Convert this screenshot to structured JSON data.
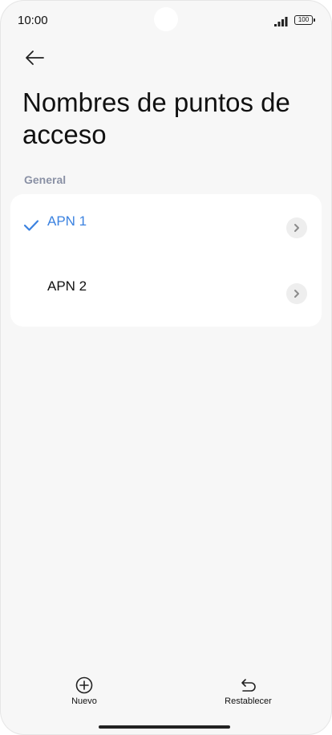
{
  "status_bar": {
    "time": "10:00",
    "battery": "100"
  },
  "header": {
    "title": "Nombres de puntos de acceso"
  },
  "section": {
    "label": "General"
  },
  "apn_list": [
    {
      "label": "APN 1",
      "selected": true
    },
    {
      "label": "APN 2",
      "selected": false
    }
  ],
  "bottom_bar": {
    "new_label": "Nuevo",
    "reset_label": "Restablecer"
  },
  "colors": {
    "accent": "#3b82e0",
    "background": "#f7f7f7",
    "card": "#ffffff"
  }
}
